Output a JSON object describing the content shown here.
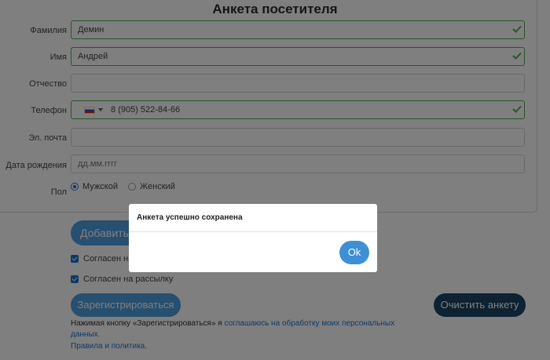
{
  "form": {
    "title": "Анкета посетителя",
    "fields": {
      "last_name": {
        "label": "Фамилия",
        "value": "Демин"
      },
      "first_name": {
        "label": "Имя",
        "value": "Андрей"
      },
      "middle_name": {
        "label": "Отчество",
        "value": ""
      },
      "phone": {
        "label": "Телефон",
        "value": "8 (905) 522-84-66",
        "country_icon": "russia-flag-icon"
      },
      "email": {
        "label": "Эл. почта",
        "value": ""
      },
      "birth_date": {
        "label": "Дата рождения",
        "placeholder": "дд.мм.гггг"
      }
    },
    "gender": {
      "label": "Пол",
      "options": [
        "Мужской",
        "Женский"
      ],
      "selected": "Мужской"
    }
  },
  "actions": {
    "add_label": "Добавить",
    "agree_label": "Согласен на",
    "subscribe_label": "Согласен на рассылку",
    "register_label": "Зарегистрироваться",
    "clear_label": "Очистить анкету",
    "consent_prefix": "Нажимая кнопку «Зарегистрироваться» я ",
    "consent_link": "соглашаюсь на обработку моих персональных данных",
    "consent_suffix": ".",
    "rules_link": "Правила и политика."
  },
  "modal": {
    "title": "Анкета успешно сохранена",
    "ok_label": "Ok"
  },
  "colors": {
    "valid_border": "#4caf50",
    "primary": "#4e9fe0",
    "dark_button": "#1b4466",
    "link": "#1e73c9"
  }
}
